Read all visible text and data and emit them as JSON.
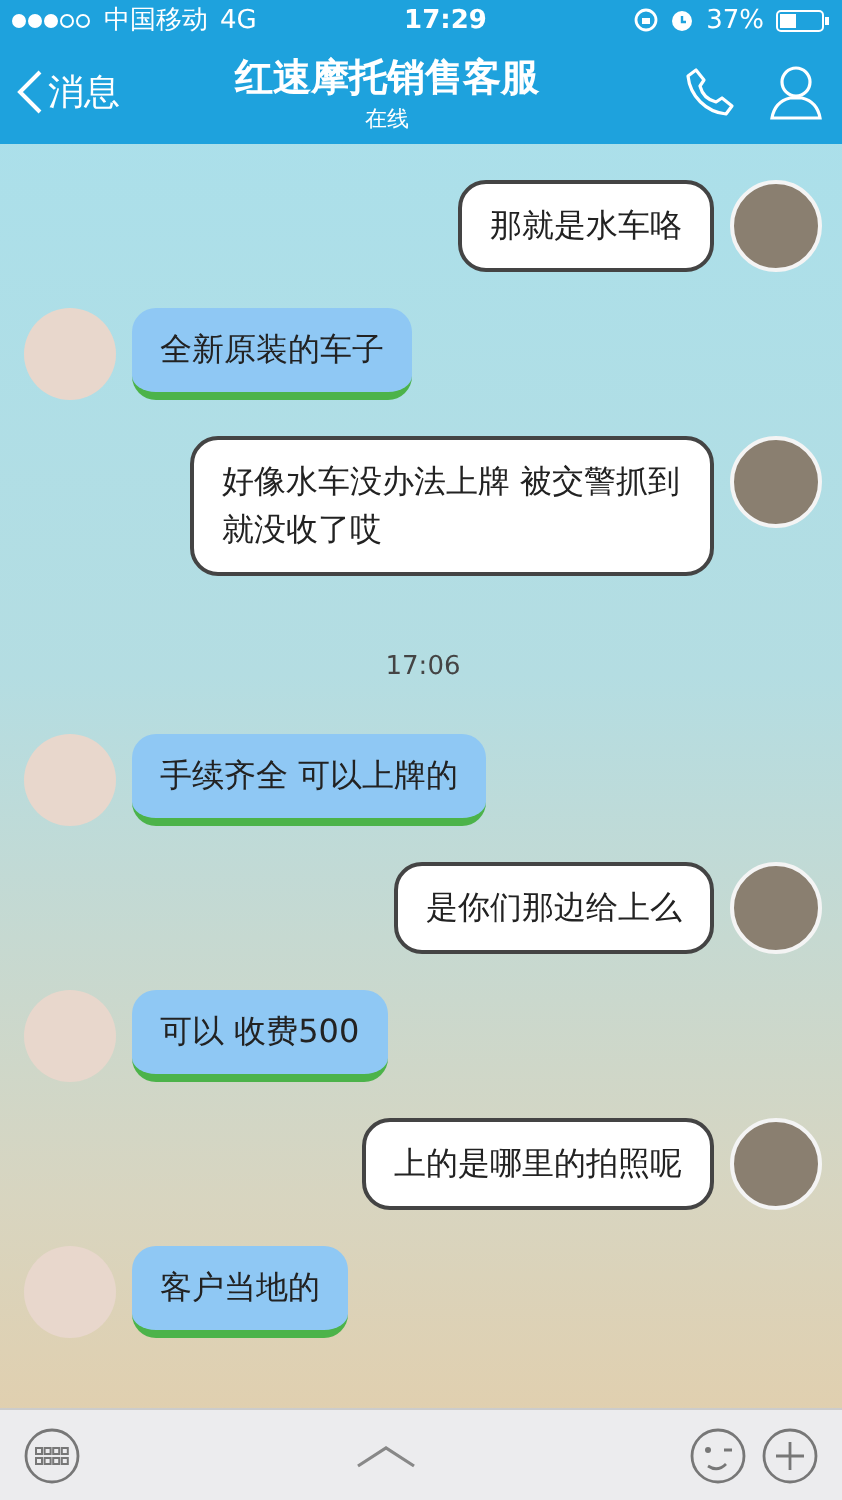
{
  "status_bar": {
    "carrier": "中国移动",
    "network": "4G",
    "time": "17:29",
    "battery": "37%"
  },
  "nav": {
    "back": "消息",
    "title": "红速摩托销售客服",
    "subtitle": "在线"
  },
  "messages": [
    {
      "kind": "sent",
      "text": "那就是水车咯"
    },
    {
      "kind": "received",
      "text": "全新原装的车子"
    },
    {
      "kind": "sent",
      "text": "好像水车没办法上牌  被交警抓到就没收了哎"
    },
    {
      "kind": "time",
      "text": "17:06"
    },
    {
      "kind": "received",
      "text": "手续齐全 可以上牌的"
    },
    {
      "kind": "sent",
      "text": "是你们那边给上么"
    },
    {
      "kind": "received",
      "text": "可以 收费500"
    },
    {
      "kind": "sent",
      "text": "上的是哪里的拍照呢"
    },
    {
      "kind": "received",
      "text": "客户当地的"
    }
  ]
}
